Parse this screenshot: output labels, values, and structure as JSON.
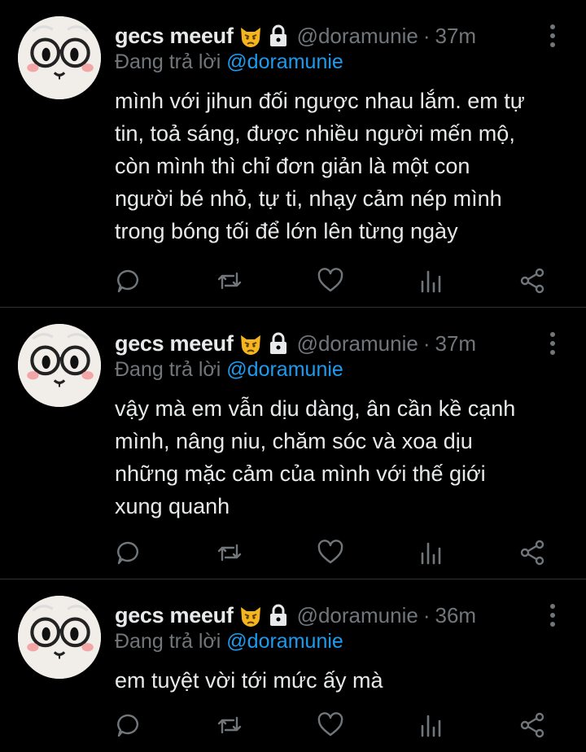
{
  "tweets": [
    {
      "display_name": "gecs meeuf",
      "handle": "@doramunie",
      "separator": "·",
      "time": "37m",
      "replying_prefix": "Đang trả lời",
      "replying_to": "@doramunie",
      "lines": [
        "mình với jihun đối ngược nhau lắm. em tự",
        "tin, toả sáng, được nhiều người mến mộ,",
        "còn mình thì chỉ đơn giản là một con",
        "người bé nhỏ, tự ti, nhạy cảm nép mình",
        "trong bóng tối để lớn lên từng ngày"
      ]
    },
    {
      "display_name": "gecs meeuf",
      "handle": "@doramunie",
      "separator": "·",
      "time": "37m",
      "replying_prefix": "Đang trả lời",
      "replying_to": "@doramunie",
      "lines": [
        "vậy mà em vẫn dịu dàng, ân cần kề cạnh",
        "mình, nâng niu, chăm sóc và xoa dịu",
        "những mặc cảm của mình với thế giới",
        "xung quanh"
      ]
    },
    {
      "display_name": "gecs meeuf",
      "handle": "@doramunie",
      "separator": "·",
      "time": "36m",
      "replying_prefix": "Đang trả lời",
      "replying_to": "@doramunie",
      "lines": [
        "em tuyệt vời tới mức ấy mà"
      ]
    }
  ],
  "icons": {
    "avatar": "cat-with-glasses-avatar",
    "name_emoji": "pouting-cat-emoji",
    "protected": "lock-icon",
    "more": "more-vertical-icon",
    "actions": [
      "reply-icon",
      "retweet-icon",
      "like-icon",
      "views-icon",
      "share-icon"
    ]
  },
  "colors": {
    "background": "#000000",
    "text": "#e7e9ea",
    "secondary": "#71767b",
    "link": "#1d9bf0",
    "divider": "#2f3336",
    "emoji": "#f5b51e"
  }
}
